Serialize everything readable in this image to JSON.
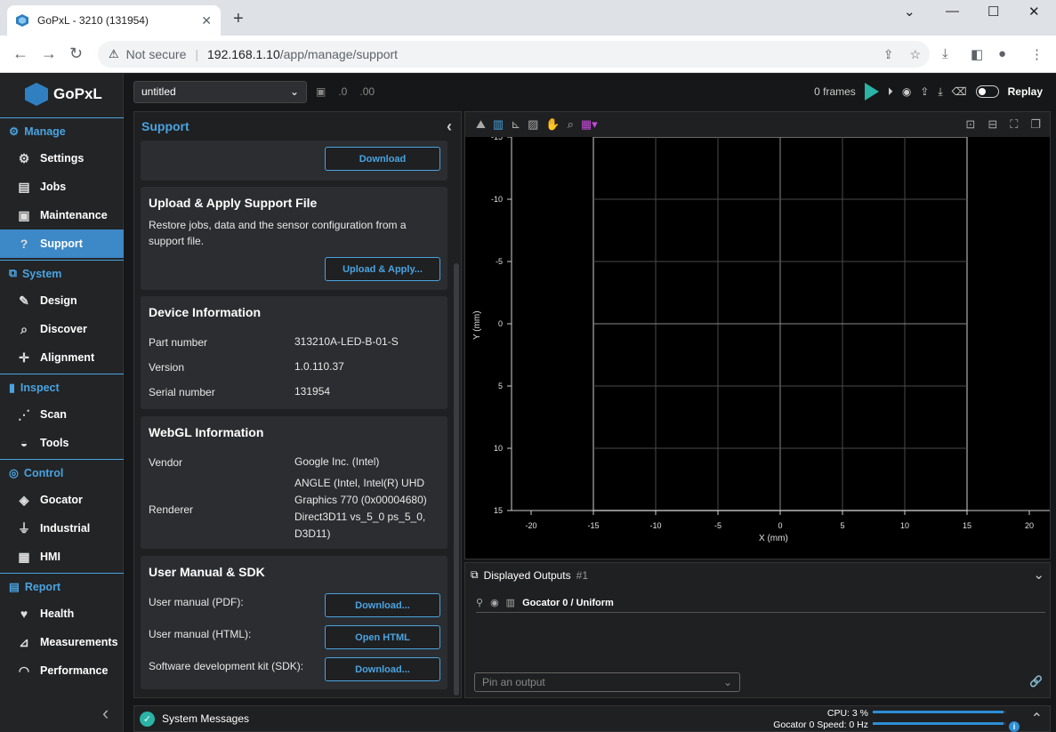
{
  "browser": {
    "tab_title": "GoPxL - 3210 (131954)",
    "close": "✕",
    "new_tab": "+",
    "security": "Not secure",
    "url_host": "192.168.1.10",
    "url_path": "/app/manage/support"
  },
  "app": {
    "brand": "GoPxL",
    "groups": [
      {
        "label": "Manage",
        "items": [
          "Settings",
          "Jobs",
          "Maintenance",
          "Support"
        ]
      },
      {
        "label": "System",
        "items": [
          "Design",
          "Discover",
          "Alignment"
        ]
      },
      {
        "label": "Inspect",
        "items": [
          "Scan",
          "Tools"
        ]
      },
      {
        "label": "Control",
        "items": [
          "Gocator",
          "Industrial",
          "HMI"
        ]
      },
      {
        "label": "Report",
        "items": [
          "Health",
          "Measurements",
          "Performance"
        ]
      }
    ],
    "active_item": "Support"
  },
  "toolbar": {
    "job": "untitled",
    "frames": "0 frames",
    "replay": "Replay"
  },
  "support": {
    "title": "Support",
    "download_btn": "Download",
    "upload": {
      "title": "Upload & Apply Support File",
      "desc_line1": "Restore jobs, data and the sensor configuration from a",
      "desc_line2": "support file.",
      "button": "Upload & Apply..."
    },
    "device": {
      "title": "Device Information",
      "rows": [
        {
          "label": "Part number",
          "value": "313210A-LED-B-01-S"
        },
        {
          "label": "Version",
          "value": "1.0.110.37"
        },
        {
          "label": "Serial number",
          "value": "131954"
        }
      ]
    },
    "webgl": {
      "title": "WebGL Information",
      "vendor_label": "Vendor",
      "vendor_value": "Google Inc. (Intel)",
      "renderer_label": "Renderer",
      "renderer_lines": [
        "ANGLE (Intel, Intel(R) UHD",
        "Graphics 770 (0x00004680)",
        "Direct3D11 vs_5_0 ps_5_0,",
        "D3D11)"
      ]
    },
    "manual": {
      "title": "User Manual & SDK",
      "rows": [
        {
          "label": "User manual (PDF):",
          "button": "Download..."
        },
        {
          "label": "User manual (HTML):",
          "button": "Open HTML"
        },
        {
          "label": "Software development kit (SDK):",
          "button": "Download..."
        }
      ]
    }
  },
  "viewer": {
    "x_label": "X (mm)",
    "y_label": "Y (mm)",
    "x_ticks": [
      "-20",
      "-15",
      "-10",
      "-5",
      "0",
      "5",
      "10",
      "15",
      "20"
    ],
    "y_ticks": [
      "-15",
      "-10",
      "-5",
      "0",
      "5",
      "10",
      "15"
    ]
  },
  "outputs": {
    "title": "Displayed Outputs",
    "count": "#1",
    "row": "Gocator 0 / Uniform",
    "pin_placeholder": "Pin an output"
  },
  "status": {
    "messages": "System Messages",
    "cpu": "CPU: 3 %",
    "speed": "Gocator 0  Speed: 0 Hz",
    "cpu_fraction": 0.03,
    "speed_fraction": 0
  }
}
